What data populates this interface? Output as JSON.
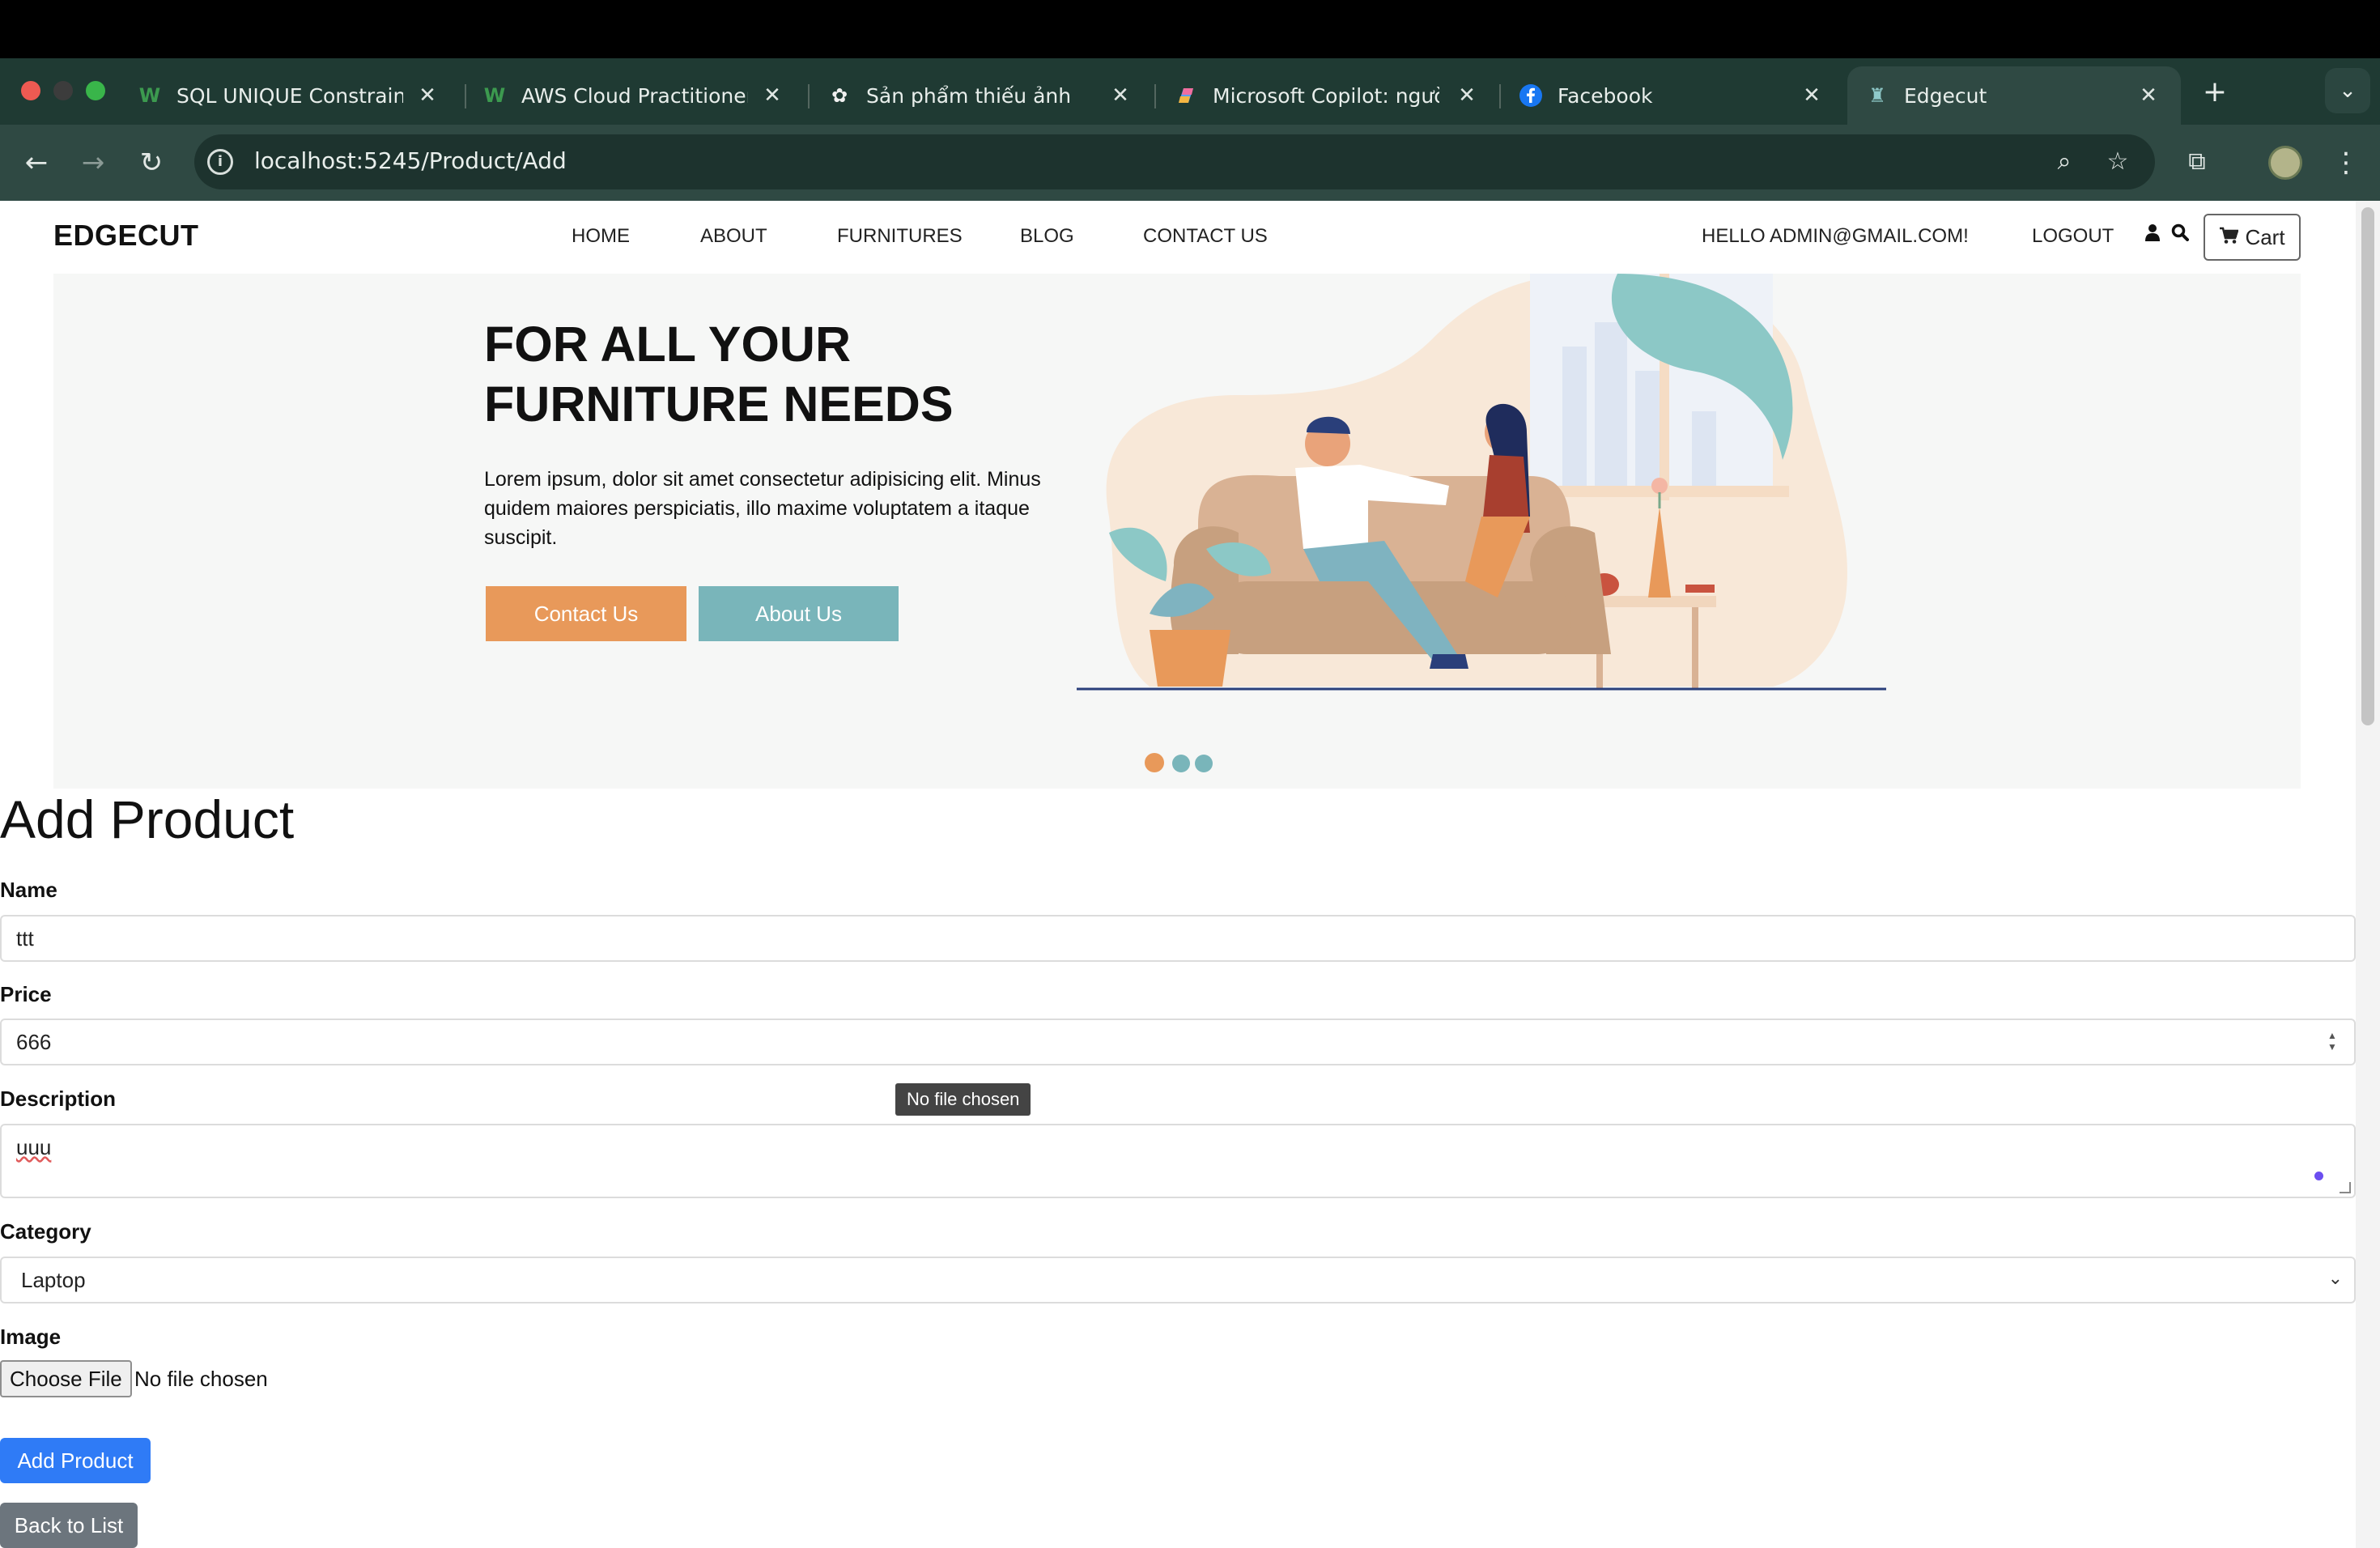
{
  "browser": {
    "tabs": [
      {
        "title": "SQL UNIQUE Constraint",
        "icon": "w3schools-icon"
      },
      {
        "title": "AWS Cloud Practitioner C",
        "icon": "w3schools-icon"
      },
      {
        "title": "Sản phẩm thiếu ảnh",
        "icon": "chatgpt-icon"
      },
      {
        "title": "Microsoft Copilot: người i",
        "icon": "copilot-icon"
      },
      {
        "title": "Facebook",
        "icon": "facebook-icon"
      },
      {
        "title": "Edgecut",
        "icon": "chair-icon"
      }
    ],
    "url": "localhost:5245/Product/Add"
  },
  "nav": {
    "brand": "EDGECUT",
    "links": [
      "HOME",
      "ABOUT",
      "FURNITURES",
      "BLOG",
      "CONTACT US"
    ],
    "greeting": "HELLO ADMIN@GMAIL.COM!",
    "logout": "LOGOUT",
    "cart": "Cart"
  },
  "hero": {
    "title_line1": "FOR ALL YOUR",
    "title_line2": "FURNITURE NEEDS",
    "text": "Lorem ipsum, dolor sit amet consectetur adipisicing elit. Minus quidem maiores perspiciatis, illo maxime voluptatem a itaque suscipit.",
    "contact_btn": "Contact Us",
    "about_btn": "About Us",
    "colors": {
      "orange": "#e8995a",
      "teal": "#79b5ba"
    }
  },
  "form": {
    "heading": "Add Product",
    "name_label": "Name",
    "name_value": "ttt",
    "price_label": "Price",
    "price_value": "666",
    "description_label": "Description",
    "description_value": "uuu",
    "category_label": "Category",
    "category_value": "Laptop",
    "image_label": "Image",
    "choose_file": "Choose File",
    "no_file": "No file chosen",
    "tooltip": "No file chosen",
    "submit": "Add Product",
    "back": "Back to List"
  }
}
